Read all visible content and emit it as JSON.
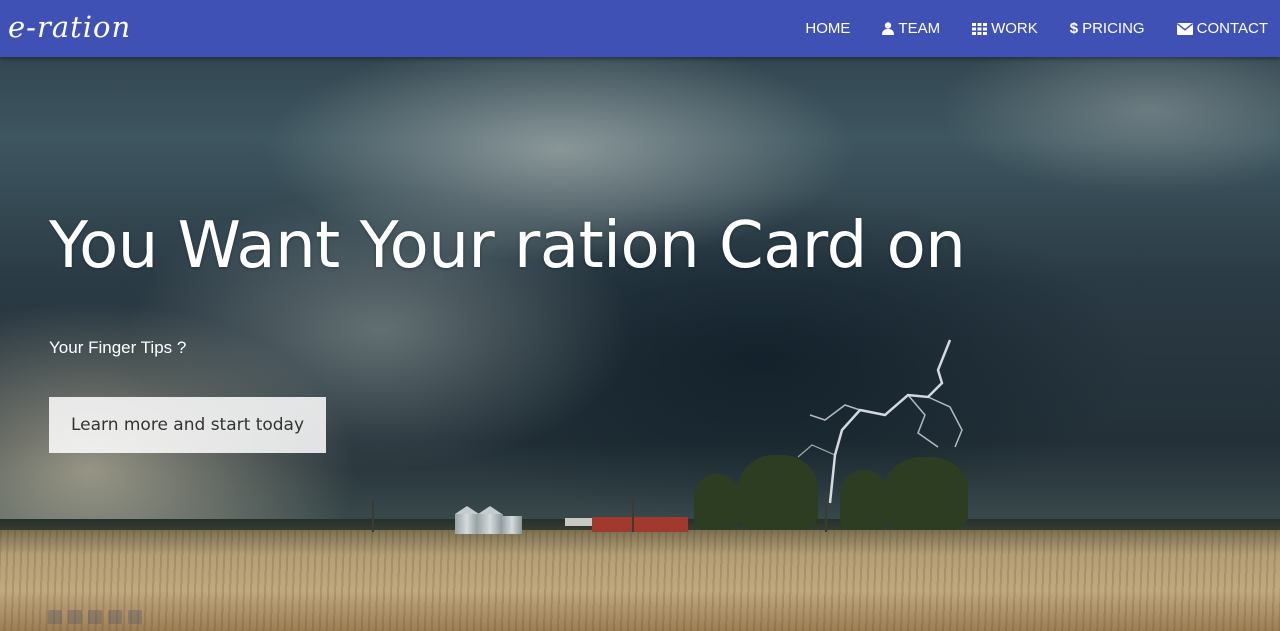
{
  "brand": {
    "logo_text": "e-ration"
  },
  "nav": {
    "items": [
      {
        "label": "HOME",
        "icon": ""
      },
      {
        "label": "TEAM",
        "icon": "user-icon"
      },
      {
        "label": "WORK",
        "icon": "grid-icon"
      },
      {
        "label": "PRICING",
        "icon": "dollar-icon"
      },
      {
        "label": "CONTACT",
        "icon": "envelope-icon"
      }
    ],
    "background_color": "#3f51b5"
  },
  "hero": {
    "headline": "You Want Your ration Card on",
    "subheadline": "Your Finger Tips ?",
    "cta_label": "Learn more and start today",
    "background_image": "storm-clouds-over-wheat-field"
  }
}
